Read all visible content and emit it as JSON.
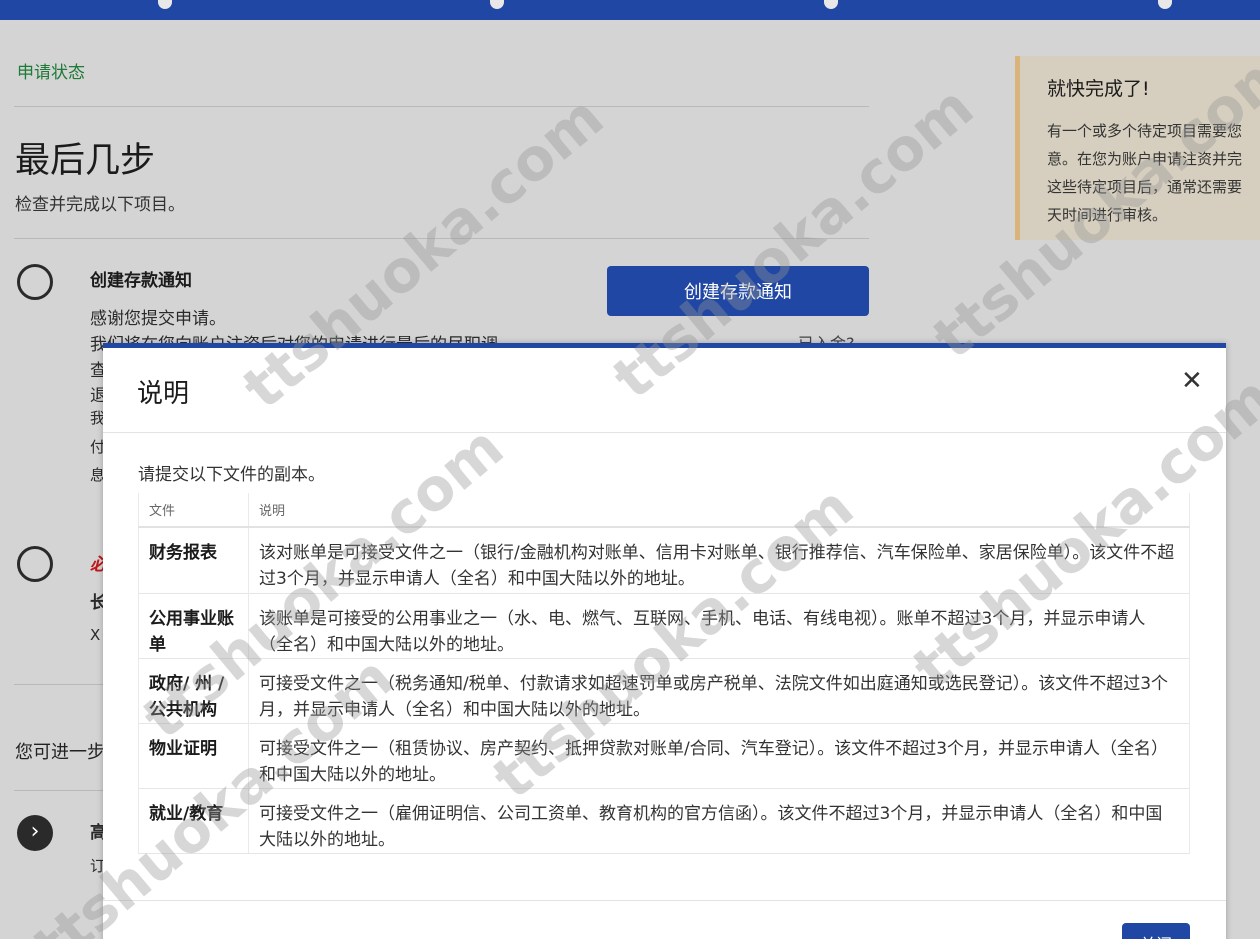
{
  "page": {
    "status_link": "申请状态",
    "title": "最后几步",
    "subtitle": "检查并完成以下项目。"
  },
  "step1": {
    "title": "创建存款通知",
    "line1": "感谢您提交申请。",
    "line2": "我们将在您向账户注资后对您的申请进行最后的尽职调",
    "frag1": "查",
    "frag2": "退",
    "frag3": "我",
    "frag4": "付",
    "frag5": "息",
    "button": "创建存款通知",
    "paid_link": "已入金?"
  },
  "step2": {
    "frag_red": "必",
    "frag_b": "长",
    "frag_x": "X"
  },
  "more": {
    "text": "您可进一步",
    "item_frag": "高",
    "item_frag2": "订"
  },
  "side_card": {
    "title": "就快完成了!",
    "line1": "有一个或多个待定项目需要您",
    "line2": "意。在您为账户申请注资并完",
    "line3": "这些待定项目后，通常还需要",
    "line4": "天时间进行审核。"
  },
  "modal": {
    "title": "说明",
    "close_icon": "close-icon",
    "intro": "请提交以下文件的副本。",
    "columns": [
      "文件",
      "说明"
    ],
    "rows": [
      {
        "doc": "财务报表",
        "desc": "该对账单是可接受文件之一（银行/金融机构对账单、信用卡对账单、银行推荐信、汽车保险单、家居保险单）。该文件不超过3个月，并显示申请人（全名）和中国大陆以外的地址。"
      },
      {
        "doc": "公用事业账单",
        "desc": "该账单是可接受的公用事业之一（水、电、燃气、互联网、手机、电话、有线电视）。账单不超过3个月，并显示申请人（全名）和中国大陆以外的地址。"
      },
      {
        "doc": "政府/ 州 / 公共机构",
        "desc": "可接受文件之一（税务通知/税单、付款请求如超速罚单或房产税单、法院文件如出庭通知或选民登记）。该文件不超过3个月，并显示申请人（全名）和中国大陆以外的地址。"
      },
      {
        "doc": "物业证明",
        "desc": "可接受文件之一（租赁协议、房产契约、抵押贷款对账单/合同、汽车登记）。该文件不超过3个月，并显示申请人（全名）和中国大陆以外的地址。"
      },
      {
        "doc": "就业/教育",
        "desc": "可接受文件之一（雇佣证明信、公司工资单、教育机构的官方信函）。该文件不超过3个月，并显示申请人（全名）和中国大陆以外的地址。"
      }
    ],
    "close_button": "关闭"
  },
  "watermark": "ttshuoka.com",
  "colors": {
    "primary": "#1f47a3",
    "status_green": "#1e7a37",
    "required_red": "#c0161b",
    "notice_border": "#d8b47a"
  }
}
